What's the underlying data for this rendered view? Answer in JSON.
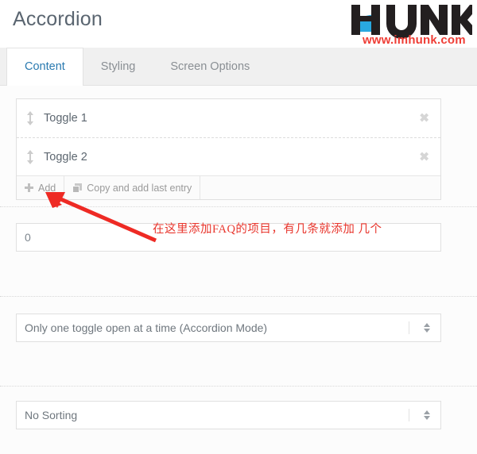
{
  "header": {
    "title": "Accordion",
    "logo": {
      "wordmark": "HUNK",
      "url": "www.imhunk.com",
      "swoosh_color": "#29a9e0",
      "wordmark_color": "#231f20",
      "url_color": "#ef3e36"
    }
  },
  "tabs": [
    {
      "label": "Content",
      "active": true
    },
    {
      "label": "Styling",
      "active": false
    },
    {
      "label": "Screen Options",
      "active": false
    }
  ],
  "toggles": [
    {
      "label": "Toggle 1",
      "drag_icon": "updown-arrows-icon",
      "remove_icon": "close-icon"
    },
    {
      "label": "Toggle 2",
      "drag_icon": "updown-arrows-icon",
      "remove_icon": "close-icon"
    }
  ],
  "panel_buttons": [
    {
      "label": "Add",
      "icon": "plus-icon"
    },
    {
      "label": "Copy and add last entry",
      "icon": "copy-icon"
    }
  ],
  "fields": {
    "number_input": {
      "value": "0",
      "placeholder": "0"
    },
    "mode_select": {
      "value": "Only one toggle open at a time (Accordion Mode)"
    },
    "sort_select": {
      "value": "No Sorting"
    }
  },
  "annotation": {
    "text": "在这里添加FAQ的项目，有几条就添加 几个",
    "color": "#e8352c",
    "arrow": "red-arrow-pointing-to-add-button"
  }
}
